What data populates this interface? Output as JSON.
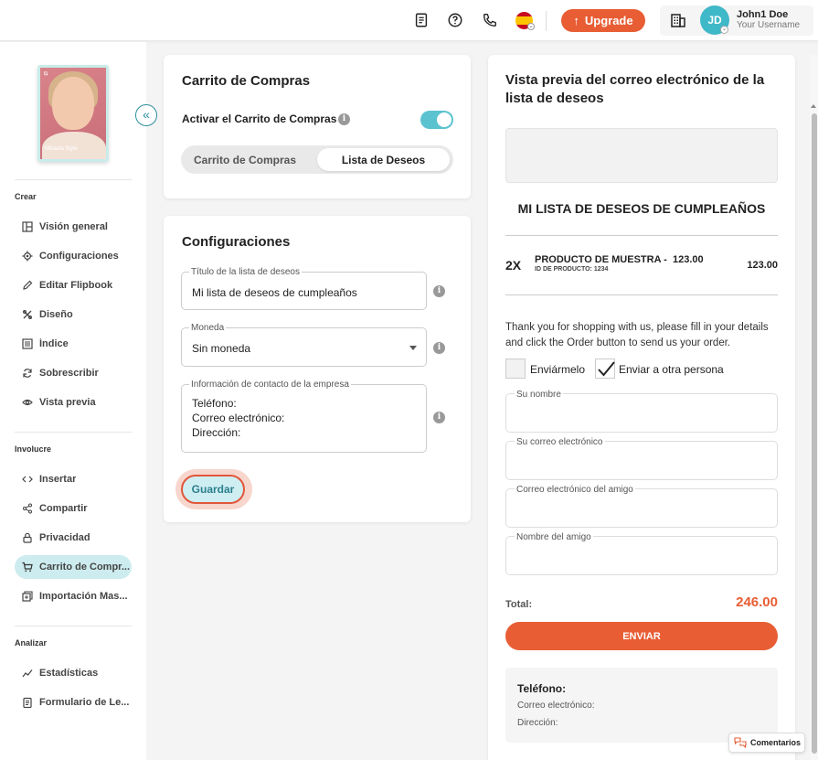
{
  "header": {
    "upgrade_label": "Upgrade",
    "user_initials": "JD",
    "user_name": "John1 Doe",
    "user_sub": "Your Username"
  },
  "sidebar": {
    "cover_text": "Mikaela Style",
    "sections": {
      "crear": "Crear",
      "involucre": "Involucre",
      "analizar": "Analizar"
    },
    "items": [
      {
        "label": "Visión general",
        "icon": "layout-icon"
      },
      {
        "label": "Configuraciones",
        "icon": "gear-icon"
      },
      {
        "label": "Editar Flipbook",
        "icon": "pencil-icon"
      },
      {
        "label": "Diseño",
        "icon": "design-tools-icon"
      },
      {
        "label": "Índice",
        "icon": "list-icon"
      },
      {
        "label": "Sobrescribir",
        "icon": "refresh-icon"
      },
      {
        "label": "Vista previa",
        "icon": "eye-icon"
      },
      {
        "label": "Insertar",
        "icon": "code-icon"
      },
      {
        "label": "Compartir",
        "icon": "share-icon"
      },
      {
        "label": "Privacidad",
        "icon": "lock-icon"
      },
      {
        "label": "Carrito de Compr...",
        "icon": "cart-icon"
      },
      {
        "label": "Importación Mas...",
        "icon": "import-icon"
      },
      {
        "label": "Estadísticas",
        "icon": "chart-icon"
      },
      {
        "label": "Formulario de Le...",
        "icon": "form-icon"
      }
    ]
  },
  "cart_card": {
    "title": "Carrito de Compras",
    "toggle_label": "Activar el Carrito de Compras",
    "toggle_on": true,
    "tab_cart": "Carrito de Compras",
    "tab_wishlist": "Lista de Deseos"
  },
  "config_card": {
    "title": "Configuraciones",
    "wishlist_title_label": "Título de la lista de deseos",
    "wishlist_title_value": "Mi lista de deseos de cumpleaños",
    "currency_label": "Moneda",
    "currency_value": "Sin moneda",
    "contact_label": "Información de contacto de la empresa",
    "contact_lines": [
      "Teléfono:",
      "Correo electrónico:",
      "Dirección:"
    ],
    "save_label": "Guardar"
  },
  "preview": {
    "title": "Vista previa del correo electrónico de la lista de deseos",
    "wishlist_name": "MI LISTA DE DESEOS DE CUMPLEAÑOS",
    "qty": "2X",
    "product_name": "PRODUCTO DE MUESTRA -",
    "product_price": "123.00",
    "product_id": "ID DE PRODUCTO: 1234",
    "line_total": "123.00",
    "thanks": "Thank you for shopping with us, please fill in your details and click the Order button to send us your order.",
    "send_me": "Enviármelo",
    "send_other": "Enviar a otra persona",
    "your_name": "Su nombre",
    "your_email": "Su correo electrónico",
    "friend_email": "Correo electrónico del amigo",
    "friend_name": "Nombre del amigo",
    "total_label": "Total:",
    "total_value": "246.00",
    "send_label": "ENVIAR",
    "contact_title": "Teléfono:",
    "contact_email": "Correo electrónico:",
    "contact_address": "Dirección:"
  },
  "feedback_label": "Comentarios",
  "colors": {
    "accent": "#e85d34",
    "teal": "#3fb8c8",
    "active_nav": "#cdecef"
  }
}
